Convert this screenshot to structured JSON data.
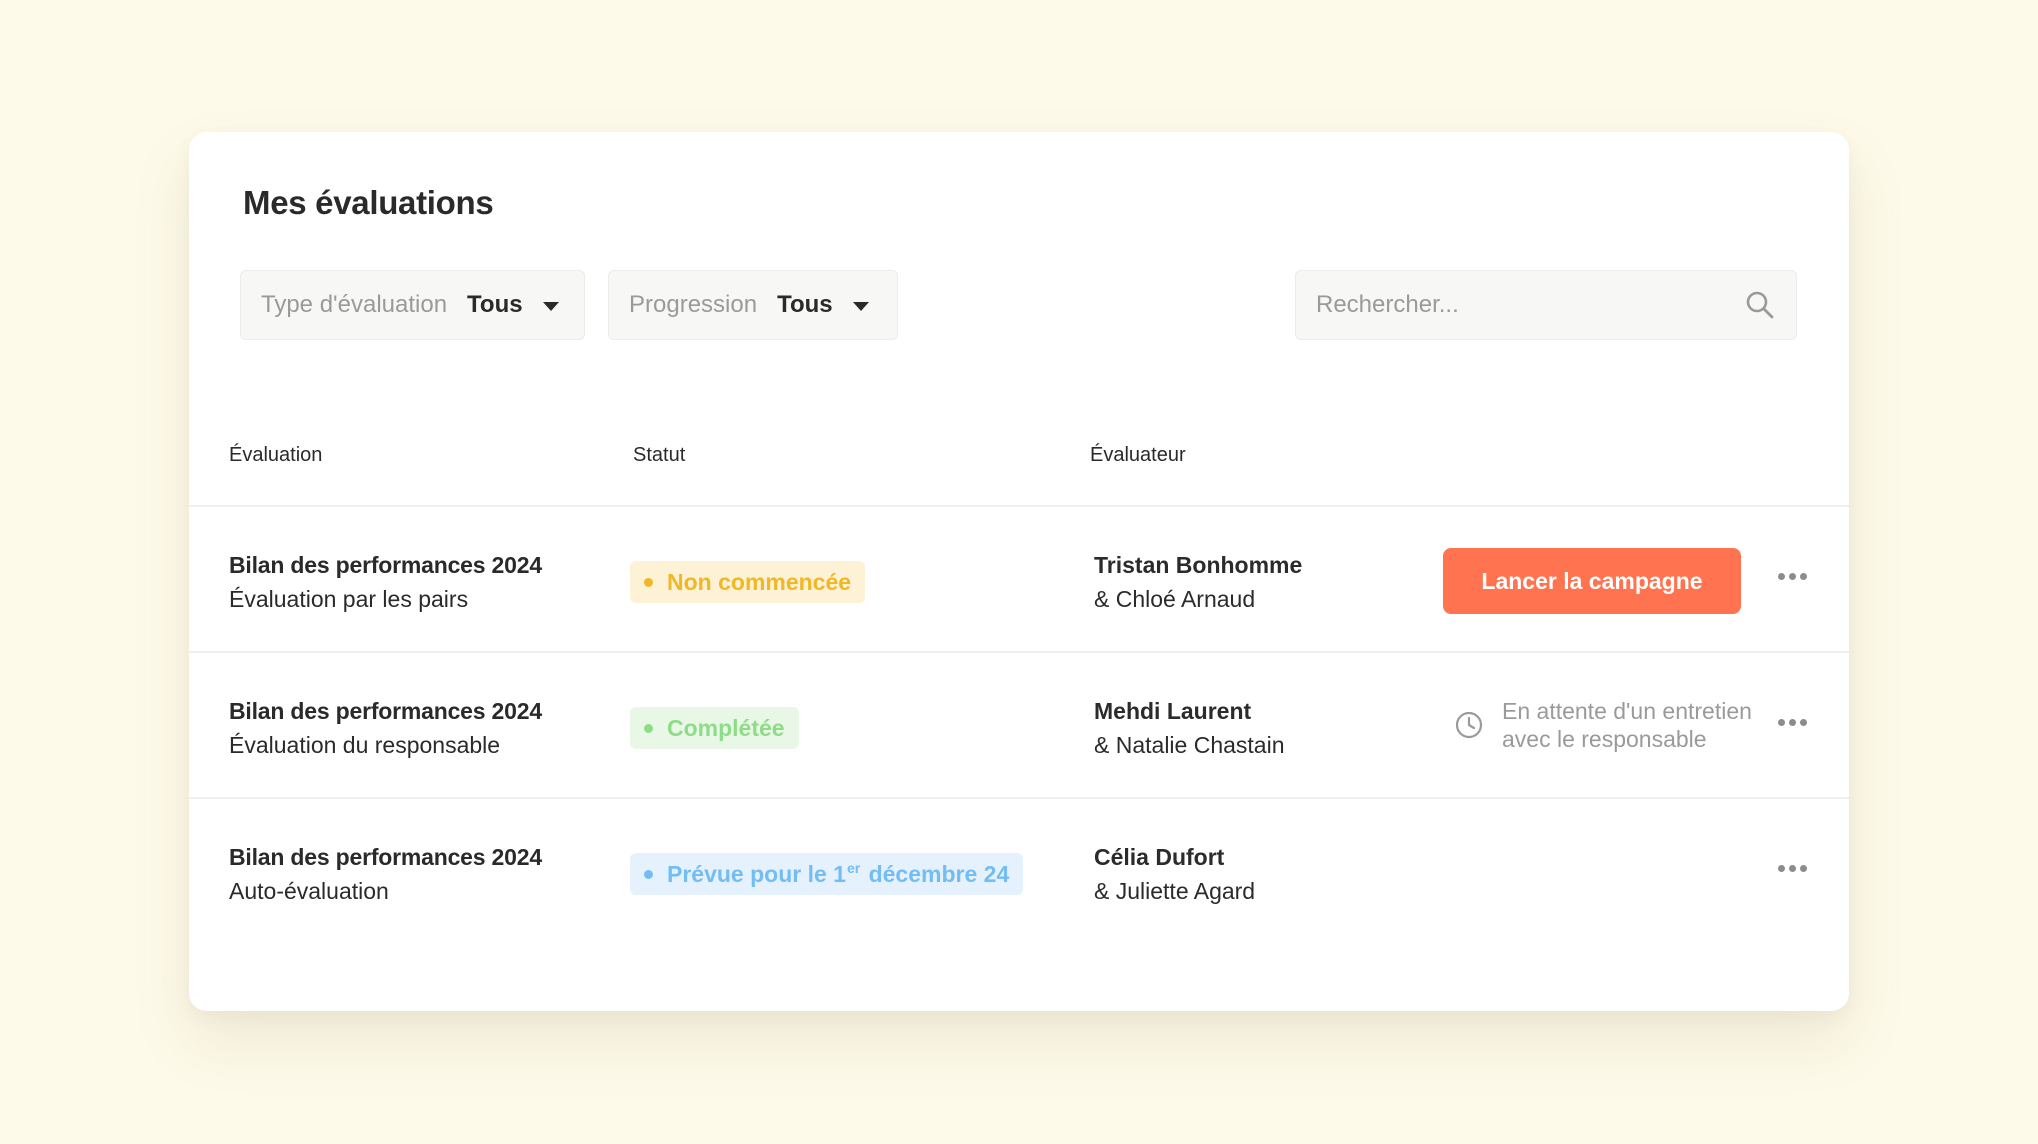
{
  "page": {
    "title": "Mes évaluations"
  },
  "filters": {
    "type": {
      "label": "Type d'évaluation",
      "value": "Tous"
    },
    "progression": {
      "label": "Progression",
      "value": "Tous"
    }
  },
  "search": {
    "placeholder": "Rechercher..."
  },
  "table": {
    "headers": {
      "evaluation": "Évaluation",
      "status": "Statut",
      "evaluator": "Évaluateur"
    },
    "rows": [
      {
        "title": "Bilan des performances 2024",
        "subtitle": "Évaluation par les pairs",
        "status": "Non commencée",
        "status_color": "#f0b824",
        "evaluator": "Tristan Bonhomme",
        "co_evaluator": "& Chloé Arnaud",
        "action_label": "Lancer la campagne"
      },
      {
        "title": "Bilan des performances 2024",
        "subtitle": "Évaluation du responsable",
        "status": "Complétée",
        "status_color": "#8fdc88",
        "evaluator": "Mehdi Laurent",
        "co_evaluator": "& Natalie Chastain",
        "pending_label": "En attente d'un entretien avec le responsable"
      },
      {
        "title": "Bilan des performances 2024",
        "subtitle": "Auto-évaluation",
        "status_prefix": "Prévue pour le 1",
        "status_sup": "er",
        "status_suffix": " décembre 24",
        "status_color": "#73bdf5",
        "evaluator": "Célia Dufort",
        "co_evaluator": "& Juliette Agard"
      }
    ]
  },
  "colors": {
    "background": "#fefae9",
    "accent": "#ff7350"
  },
  "icons": {
    "search": "search-icon",
    "caret": "caret-down-icon",
    "clock": "clock-icon",
    "more": "more-horizontal-icon"
  }
}
